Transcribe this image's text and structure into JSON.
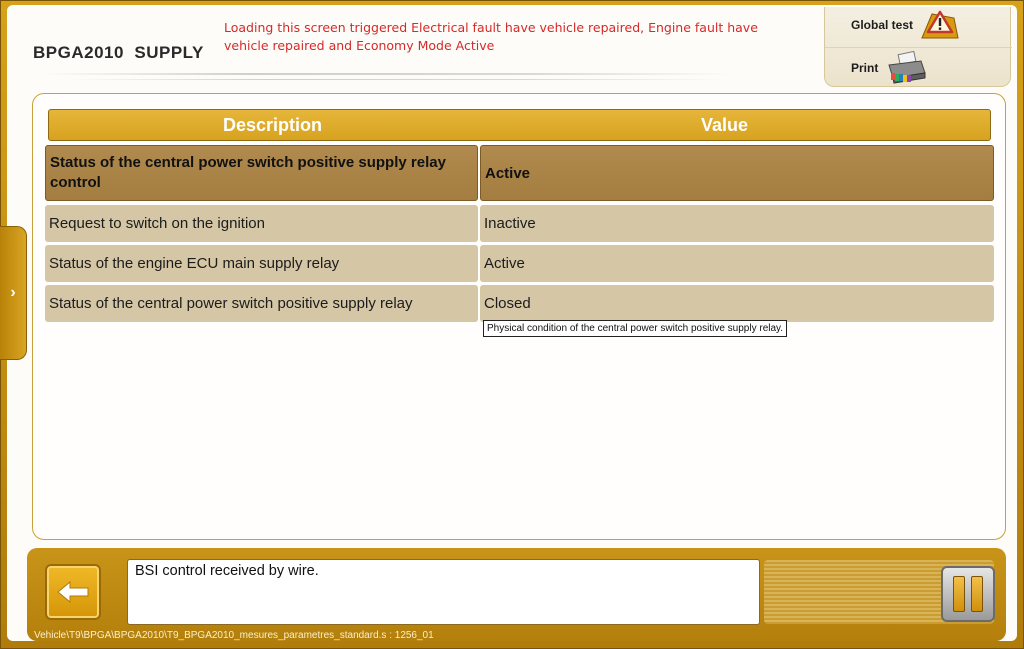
{
  "header": {
    "title": "BPGA2010  SUPPLY",
    "notice": "Loading this screen triggered Electrical fault have vehicle repaired, Engine fault have vehicle repaired and Economy Mode Active"
  },
  "actions": {
    "global_test_label": "Global test",
    "print_label": "Print"
  },
  "table": {
    "columns": [
      "Description",
      "Value"
    ],
    "rows": [
      {
        "description": "Status of the central power switch positive supply relay control",
        "value": "Active"
      },
      {
        "description": "Request to switch on the ignition",
        "value": "Inactive"
      },
      {
        "description": "Status of the engine ECU main supply relay",
        "value": "Active"
      },
      {
        "description": "Status of the central power switch positive supply relay",
        "value": "Closed"
      }
    ],
    "tooltip": "Physical condition of the central power switch positive supply relay."
  },
  "footer": {
    "message": "BSI control received by wire.",
    "path": "Vehicle\\T9\\BPGA\\BPGA2010\\T9_BPGA2010_mesures_parametres_standard.s : 1256_01"
  },
  "colors": {
    "frame": "#c08a10",
    "header_gold": "#dfac2c",
    "row_bg": "#d5c6a6",
    "row_selected": "#a9844a",
    "notice_red": "#d42a2a"
  },
  "icons": {
    "global_test": "warning-triangle-icon",
    "print": "printer-icon",
    "back": "back-arrow-icon",
    "pause": "pause-icon",
    "expand": "chevron-right-icon"
  }
}
